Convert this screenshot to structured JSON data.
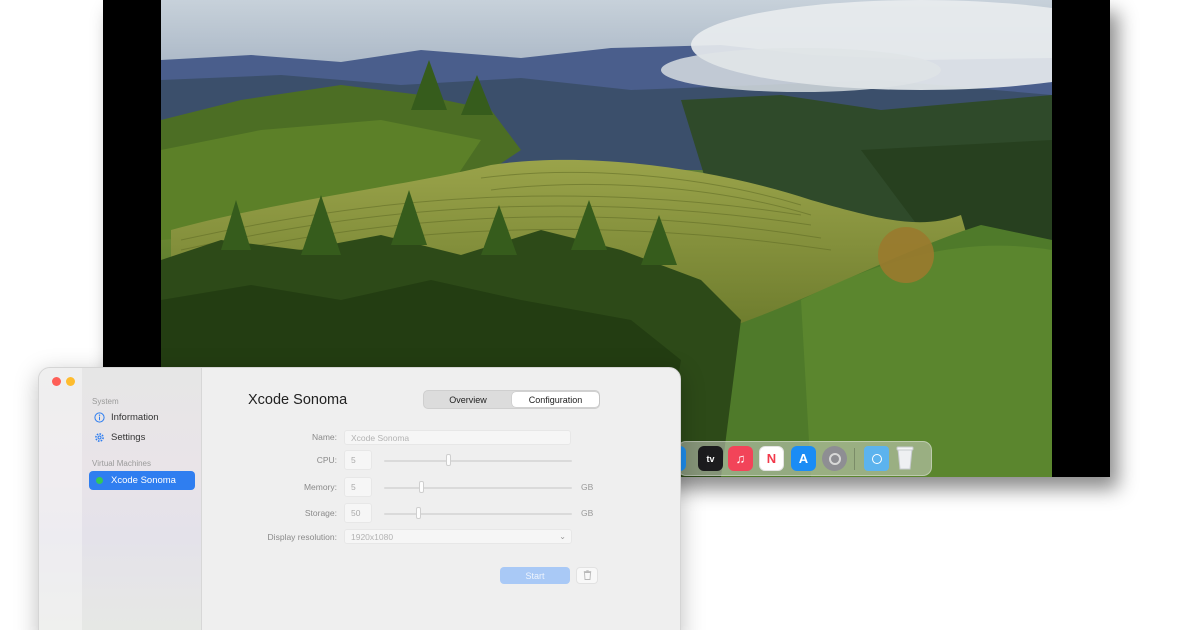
{
  "sidebar": {
    "sections": [
      {
        "label": "System",
        "items": [
          {
            "label": "Information",
            "icon": "info-icon"
          },
          {
            "label": "Settings",
            "icon": "gear-icon"
          }
        ]
      },
      {
        "label": "Virtual Machines",
        "items": [
          {
            "label": "Xcode Sonoma",
            "icon": "vm-status-dot-icon",
            "selected": true
          }
        ]
      }
    ]
  },
  "main": {
    "title": "Xcode Sonoma",
    "tabs": [
      {
        "label": "Overview",
        "selected": false
      },
      {
        "label": "Configuration",
        "selected": true
      }
    ],
    "form": {
      "name": {
        "label": "Name:",
        "placeholder": "Xcode Sonoma"
      },
      "cpu": {
        "label": "CPU:",
        "value": "5"
      },
      "memory": {
        "label": "Memory:",
        "value": "5",
        "unit": "GB"
      },
      "storage": {
        "label": "Storage:",
        "value": "50",
        "unit": "GB"
      },
      "display": {
        "label": "Display resolution:",
        "value": "1920x1080"
      }
    },
    "actions": {
      "start_label": "Start",
      "delete_icon": "trash-icon"
    }
  },
  "dock": {
    "icons": [
      "safari-icon",
      "apple-tv-icon",
      "music-icon",
      "news-icon",
      "app-store-icon",
      "system-settings-icon",
      "downloads-folder-icon",
      "trash-icon"
    ],
    "tv_label": "tv"
  },
  "colors": {
    "accent": "#2f7ef0",
    "start_disabled": "#a9c9f6",
    "status_green": "#34c759"
  }
}
